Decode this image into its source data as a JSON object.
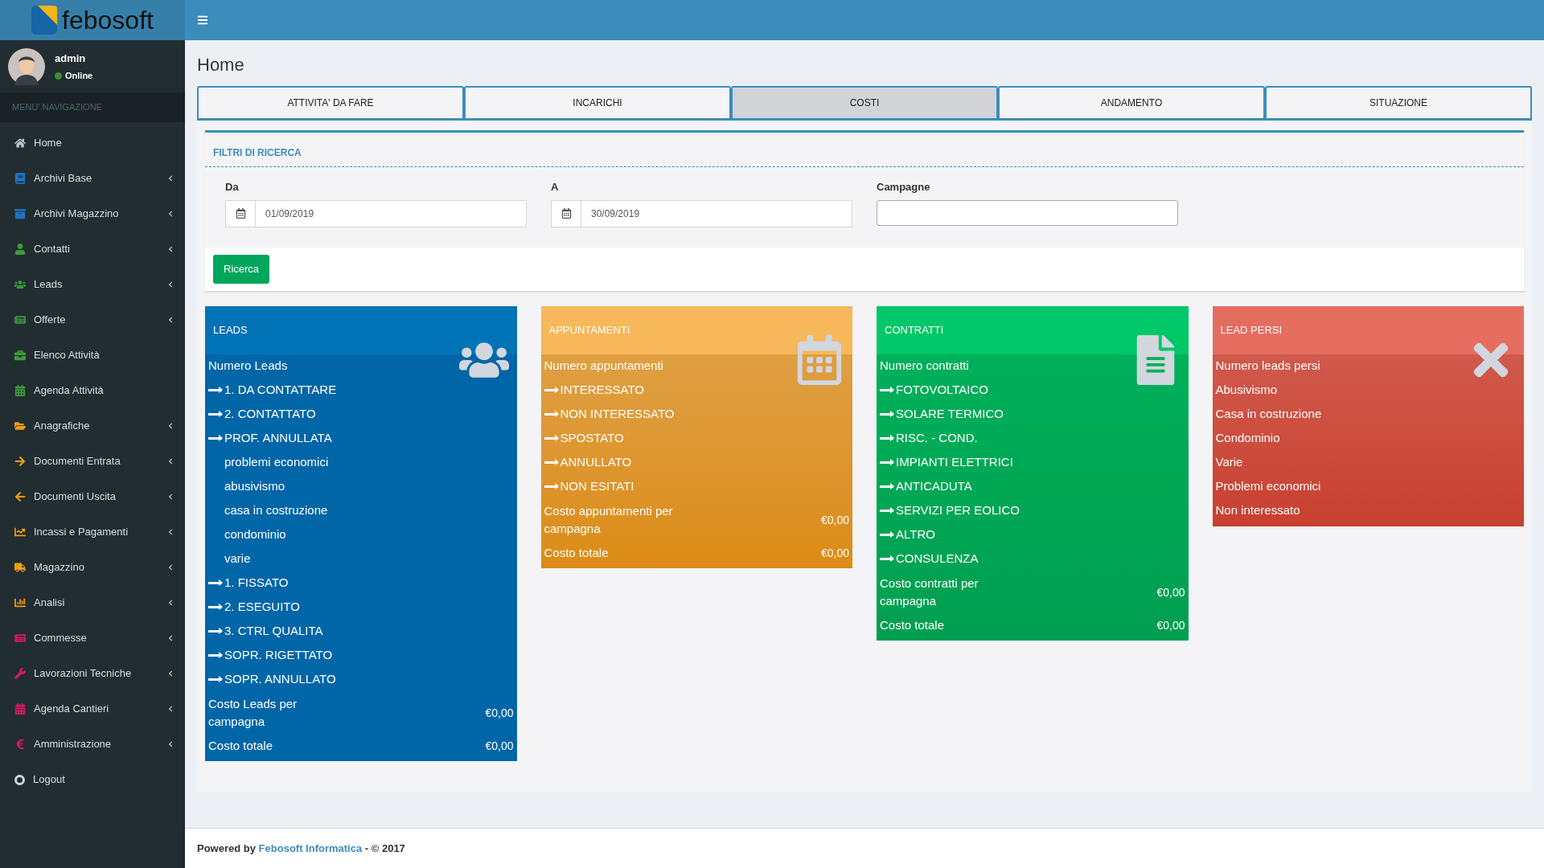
{
  "brand": {
    "logo_text": "febosoft"
  },
  "user": {
    "name": "admin",
    "status": "Online",
    "online": true
  },
  "sidebar": {
    "heading": "MENU' NAVIGAZIONE",
    "items": [
      {
        "label": "Home",
        "color": "#b8c7ce",
        "expandable": false
      },
      {
        "label": "Archivi Base",
        "color": "#1e73be",
        "expandable": true
      },
      {
        "label": "Archivi Magazzino",
        "color": "#1e73be",
        "expandable": true
      },
      {
        "label": "Contatti",
        "color": "#3c9a3c",
        "expandable": true
      },
      {
        "label": "Leads",
        "color": "#3c9a3c",
        "expandable": true
      },
      {
        "label": "Offerte",
        "color": "#3c9a3c",
        "expandable": true
      },
      {
        "label": "Elenco Attività",
        "color": "#3c9a3c",
        "expandable": false
      },
      {
        "label": "Agenda Attività",
        "color": "#3c9a3c",
        "expandable": false
      },
      {
        "label": "Anagrafiche",
        "color": "#f39c12",
        "expandable": true
      },
      {
        "label": "Documenti Entrata",
        "color": "#f39c12",
        "expandable": true
      },
      {
        "label": "Documenti Uscita",
        "color": "#f39c12",
        "expandable": true
      },
      {
        "label": "Incassi e Pagamenti",
        "color": "#f39c12",
        "expandable": true
      },
      {
        "label": "Magazzino",
        "color": "#f39c12",
        "expandable": true
      },
      {
        "label": "Analisi",
        "color": "#f39c12",
        "expandable": true
      },
      {
        "label": "Commesse",
        "color": "#d81b60",
        "expandable": true
      },
      {
        "label": "Lavorazioni Tecniche",
        "color": "#d81b60",
        "expandable": true
      },
      {
        "label": "Agenda Cantieri",
        "color": "#d81b60",
        "expandable": true
      },
      {
        "label": "Amministrazione",
        "color": "#d81b60",
        "expandable": true
      },
      {
        "label": "Logout",
        "color": "#d2d6de",
        "expandable": false
      }
    ]
  },
  "page": {
    "title": "Home"
  },
  "tabs": [
    {
      "label": "ATTIVITA' DA FARE",
      "selected": false
    },
    {
      "label": "INCARICHI",
      "selected": false
    },
    {
      "label": "COSTI",
      "selected": true
    },
    {
      "label": "ANDAMENTO",
      "selected": false
    },
    {
      "label": "SITUAZIONE",
      "selected": false
    }
  ],
  "filters": {
    "title": "FILTRI DI RICERCA",
    "fields": [
      {
        "label": "Da",
        "value": "01/09/2019",
        "kind": "date"
      },
      {
        "label": "A",
        "value": "30/09/2019",
        "kind": "date"
      },
      {
        "label": "Campagne",
        "kind": "text"
      }
    ],
    "button": "Ricerca"
  },
  "cards": [
    {
      "kind": "leads",
      "title": "LEADS",
      "rows": [
        {
          "kind": "plain",
          "text": "Numero Leads"
        },
        {
          "kind": "arrow",
          "text": "1. DA CONTATTARE"
        },
        {
          "kind": "arrow",
          "text": "2. CONTATTATO"
        },
        {
          "kind": "arrow",
          "text": "PROF. ANNULLATA"
        },
        {
          "kind": "sub",
          "text": "problemi economici"
        },
        {
          "kind": "sub",
          "text": "abusivismo"
        },
        {
          "kind": "sub",
          "text": "casa in costruzione"
        },
        {
          "kind": "sub",
          "text": "condominio"
        },
        {
          "kind": "sub",
          "text": "varie"
        },
        {
          "kind": "arrow",
          "text": "1. FISSATO"
        },
        {
          "kind": "arrow",
          "text": "2. ESEGUITO"
        },
        {
          "kind": "arrow",
          "text": "3. CTRL QUALITA"
        },
        {
          "kind": "arrow",
          "text": "SOPR. RIGETTATO"
        },
        {
          "kind": "arrow",
          "text": "SOPR. ANNULLATO"
        },
        {
          "kind": "cost",
          "text": "Costo Leads per campagna",
          "value": "€0,00"
        },
        {
          "kind": "cost",
          "text": "Costo totale",
          "value": "€0,00"
        }
      ]
    },
    {
      "kind": "appointments",
      "title": "APPUNTAMENTI",
      "rows": [
        {
          "kind": "plain",
          "text": "Numero appuntamenti"
        },
        {
          "kind": "arrow",
          "text": "INTERESSATO"
        },
        {
          "kind": "arrow",
          "text": "NON INTERESSATO"
        },
        {
          "kind": "arrow",
          "text": "SPOSTATO"
        },
        {
          "kind": "arrow",
          "text": "ANNULLATO"
        },
        {
          "kind": "arrow",
          "text": "NON ESITATI"
        },
        {
          "kind": "cost",
          "text": "Costo appuntamenti per campagna",
          "value": "€0,00"
        },
        {
          "kind": "cost",
          "text": "Costo totale",
          "value": "€0,00"
        }
      ]
    },
    {
      "kind": "contracts",
      "title": "CONTRATTI",
      "rows": [
        {
          "kind": "plain",
          "text": "Numero contratti"
        },
        {
          "kind": "arrow",
          "text": "FOTOVOLTAICO"
        },
        {
          "kind": "arrow",
          "text": "SOLARE TERMICO"
        },
        {
          "kind": "arrow",
          "text": "RISC. - COND."
        },
        {
          "kind": "arrow",
          "text": "IMPIANTI ELETTRICI"
        },
        {
          "kind": "arrow",
          "text": "ANTICADUTA"
        },
        {
          "kind": "arrow",
          "text": "SERVIZI PER EOLICO"
        },
        {
          "kind": "arrow",
          "text": "ALTRO"
        },
        {
          "kind": "arrow",
          "text": "CONSULENZA"
        },
        {
          "kind": "cost",
          "text": "Costo contratti per campagna",
          "value": "€0,00"
        },
        {
          "kind": "cost",
          "text": "Costo totale",
          "value": "€0,00"
        }
      ]
    },
    {
      "kind": "lost",
      "title": "LEAD PERSI",
      "rows": [
        {
          "kind": "plain",
          "text": "Numero leads persi"
        },
        {
          "kind": "plain",
          "text": "Abusivismo"
        },
        {
          "kind": "plain",
          "text": "Casa in costruzione"
        },
        {
          "kind": "plain",
          "text": "Condominio"
        },
        {
          "kind": "plain",
          "text": "Varie"
        },
        {
          "kind": "plain",
          "text": "Problemi economici"
        },
        {
          "kind": "plain",
          "text": "Non interessato"
        }
      ]
    }
  ],
  "footer": {
    "prefix": "Powered by",
    "link": "Febosoft Informatica",
    "suffix": "- © 2017"
  }
}
